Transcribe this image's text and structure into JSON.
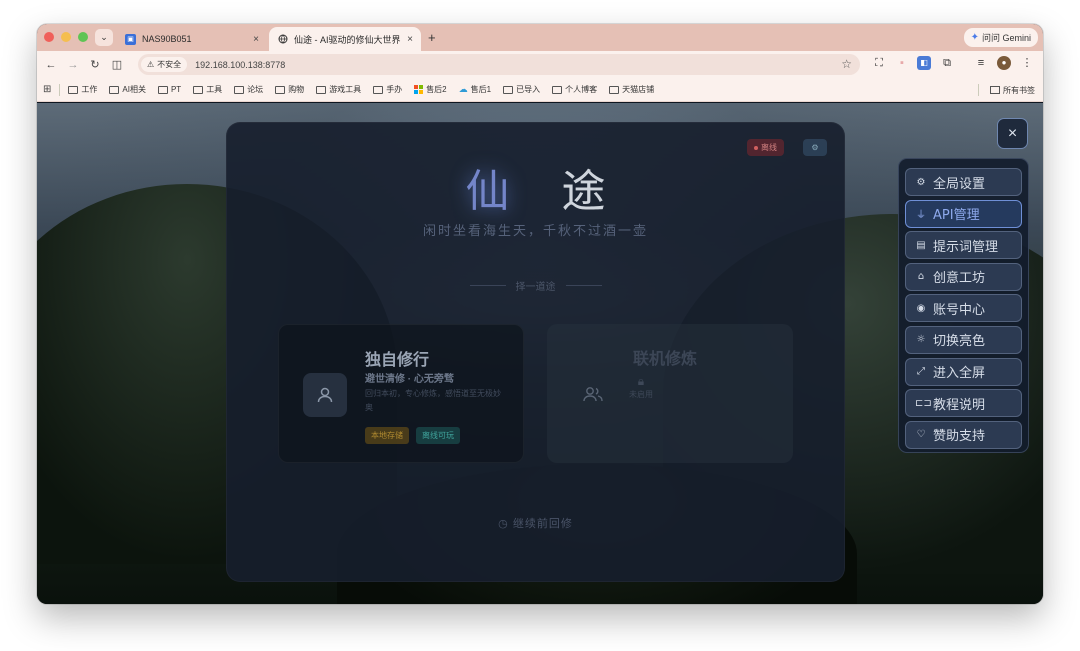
{
  "browser": {
    "tabs": [
      {
        "title": "NAS90B051",
        "close": "×"
      },
      {
        "title": "仙途 - AI驱动的修仙大世界 | AI",
        "close": "×"
      }
    ],
    "new_tab": "+",
    "gemini_label": "问问 Gemini",
    "security_label": "不安全",
    "url": "192.168.100.138:8778",
    "bookmarks": [
      "工作",
      "AI相关",
      "PT",
      "工具",
      "论坛",
      "购物",
      "游戏工具",
      "手办",
      "售后2",
      "售后1",
      "已导入",
      "个人博客",
      "天猫店铺"
    ],
    "all_bookmarks": "所有书签"
  },
  "page": {
    "status_online": "离线",
    "logo_char1": "仙",
    "logo_char2": "途",
    "tagline": "闲时坐看海生天，千秋不过酒一壶",
    "choose_label": "择一道途",
    "solo": {
      "title": "独自修行",
      "subtitle": "避世清修 · 心无旁骛",
      "description": "回归本初，专心修炼，感悟道至无极妙奥",
      "tags": [
        "本地存储",
        "离线可玩"
      ]
    },
    "multi": {
      "title": "联机修炼",
      "status": "未启用"
    },
    "continue_label": "继续前回修"
  },
  "menu": {
    "close": "×",
    "items": [
      {
        "label": "全局设置",
        "icon": "gear-icon"
      },
      {
        "label": "API管理",
        "icon": "plug-icon"
      },
      {
        "label": "提示词管理",
        "icon": "document-icon"
      },
      {
        "label": "创意工坊",
        "icon": "store-icon"
      },
      {
        "label": "账号中心",
        "icon": "user-circle-icon"
      },
      {
        "label": "切换亮色",
        "icon": "sun-icon"
      },
      {
        "label": "进入全屏",
        "icon": "expand-icon"
      },
      {
        "label": "教程说明",
        "icon": "book-icon"
      },
      {
        "label": "赞助支持",
        "icon": "heart-icon"
      }
    ],
    "active_index": 1
  },
  "colors": {
    "tab_strip": "#e5c0b5",
    "toolbar": "#fbf1ed",
    "menu_bg": "#1c2638",
    "menu_item_bg": "#2c3a52",
    "menu_active_text": "#8ea9ec",
    "logo_accent": "#7485c9"
  }
}
